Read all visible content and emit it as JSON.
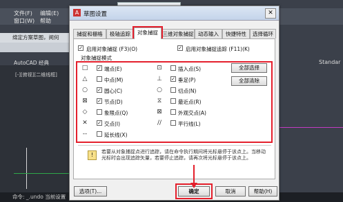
{
  "background": {
    "menu": [
      "文件(F)",
      "编辑(E)",
      "窗口(W)",
      "帮助"
    ],
    "file_tab": "绵定方案草图，阅何",
    "workspace": "AutoCAD 经典",
    "viewport_label": "[-][俯视][二维线框]",
    "right_label": "Standar",
    "status_text": "命令: _.undo 当前设置"
  },
  "dialog": {
    "title": "草图设置",
    "tabs": [
      "捕捉和栅格",
      "极轴追踪",
      "对象捕捉",
      "三维对象捕捉",
      "动态输入",
      "快捷特性",
      "选择循环"
    ],
    "enable_osnap": "启用对象捕捉 (F3)(O)",
    "enable_tracking": "启用对象捕捉追踪 (F11)(K)",
    "mode_group": "对象捕捉模式",
    "modes_left": [
      {
        "symbol": "□",
        "label": "端点(E)",
        "checked": true
      },
      {
        "symbol": "△",
        "label": "中点(M)",
        "checked": false
      },
      {
        "symbol": "○",
        "label": "圆心(C)",
        "checked": true
      },
      {
        "symbol": "⊠",
        "label": "节点(D)",
        "checked": true
      },
      {
        "symbol": "◇",
        "label": "象限点(Q)",
        "checked": false
      },
      {
        "symbol": "✕",
        "label": "交点(I)",
        "checked": true
      },
      {
        "symbol": "--",
        "label": "延长线(X)",
        "checked": false
      }
    ],
    "modes_right": [
      {
        "symbol": "⊡",
        "label": "插入点(S)",
        "checked": false
      },
      {
        "symbol": "⊥",
        "label": "垂足(P)",
        "checked": true
      },
      {
        "symbol": "○",
        "label": "切点(N)",
        "checked": false
      },
      {
        "symbol": "⧖",
        "label": "最近点(R)",
        "checked": false
      },
      {
        "symbol": "⊠",
        "label": "外观交点(A)",
        "checked": false
      },
      {
        "symbol": "//",
        "label": "平行线(L)",
        "checked": false
      }
    ],
    "select_all": "全部选择",
    "clear_all": "全部清除",
    "info": "若要从对象捕捉点进行追踪，请在命令执行期间将光标悬停于该点上。当移动光标时会出现追踪矢量，若要停止追踪，请再次将光标悬停于该点上。",
    "options_button": "选项(T)...",
    "ok_button": "确定",
    "cancel_button": "取消",
    "help_button": "帮助(H)",
    "accent": "#e41e2b"
  }
}
